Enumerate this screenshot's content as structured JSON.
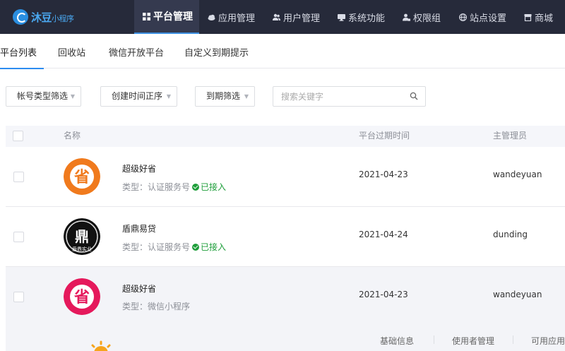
{
  "logo": {
    "text": "沐豆",
    "sub": "小程序"
  },
  "nav": [
    {
      "label": "平台管理",
      "icon": "grid-icon",
      "active": true
    },
    {
      "label": "应用管理",
      "icon": "cloud-icon",
      "active": false
    },
    {
      "label": "用户管理",
      "icon": "users-icon",
      "active": false
    },
    {
      "label": "系统功能",
      "icon": "monitor-icon",
      "active": false
    },
    {
      "label": "权限组",
      "icon": "user-lock-icon",
      "active": false
    },
    {
      "label": "站点设置",
      "icon": "globe-icon",
      "active": false
    },
    {
      "label": "商城",
      "icon": "store-icon",
      "active": false
    }
  ],
  "subtabs": [
    {
      "label": "平台列表",
      "active": true
    },
    {
      "label": "回收站",
      "active": false
    },
    {
      "label": "微信开放平台",
      "active": false
    },
    {
      "label": "自定义到期提示",
      "active": false
    }
  ],
  "filters": {
    "account_type": "帐号类型筛选",
    "create_time": "创建时间正序",
    "expiry": "到期筛选",
    "search_placeholder": "搜索关键字"
  },
  "table": {
    "headers": {
      "name": "名称",
      "expire": "平台过期时间",
      "admin": "主管理员"
    },
    "rows": [
      {
        "name": "超级好省",
        "type": "类型：认证服务号",
        "status": "已接入",
        "date": "2021-04-23",
        "admin": "wandeyuan",
        "avatar_text": "省",
        "avatar_color": "#f07a1d"
      },
      {
        "name": "盾鼎易贷",
        "type": "类型：认证服务号",
        "status": "已接入",
        "date": "2021-04-24",
        "admin": "dunding",
        "avatar_text": "鼎",
        "avatar_sub": "盾鼎实业",
        "avatar_color": "#111111"
      },
      {
        "name": "超级好省",
        "type": "类型：微信小程序",
        "status": "",
        "date": "2021-04-23",
        "admin": "wandeyuan",
        "avatar_text": "省",
        "avatar_color": "#e5195c"
      }
    ]
  },
  "row_actions": [
    "基础信息",
    "使用者管理",
    "可用应用"
  ],
  "colors": {
    "topbar": "#262a3a",
    "accent": "#2d8cf0",
    "success": "#1e9e3a"
  }
}
